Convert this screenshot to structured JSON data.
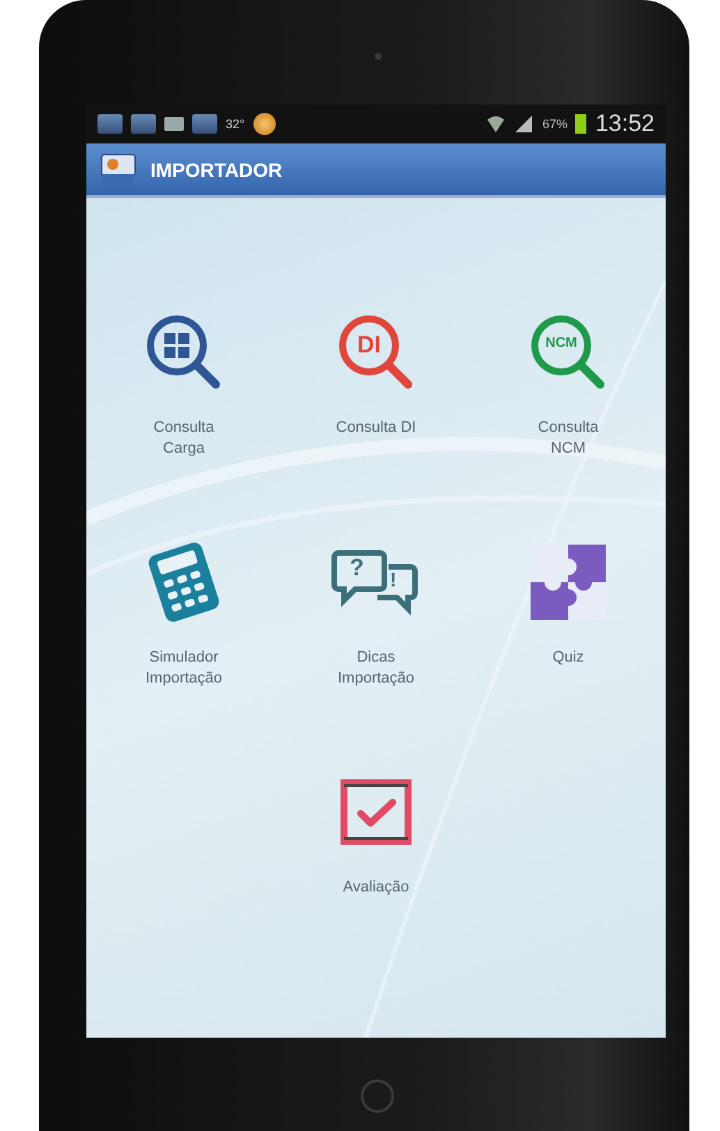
{
  "status_bar": {
    "temperature": "32°",
    "battery": "67%",
    "time": "13:52"
  },
  "app_bar": {
    "title": "IMPORTADOR"
  },
  "rows": [
    [
      {
        "label": "Consulta Carga",
        "kind": "magnifier-grid",
        "color": "#2e5594"
      },
      {
        "label": "Consulta DI",
        "kind": "magnifier-text",
        "color": "#e0463c",
        "glyph": "DI"
      },
      {
        "label": "Consulta NCM",
        "kind": "magnifier-text",
        "color": "#1f9a4a",
        "glyph": "NCM"
      }
    ],
    [
      {
        "label": "Simulador Importação",
        "kind": "calculator",
        "color": "#1b7f9e"
      },
      {
        "label": "Dicas Importação",
        "kind": "bubbles",
        "color": "#3d6f7a",
        "glyphs": [
          "?",
          "!"
        ]
      },
      {
        "label": "Quiz",
        "kind": "puzzle",
        "color": "#7a5cc0"
      }
    ],
    [
      {
        "label": "Avaliação",
        "kind": "checkbox",
        "color": "#e04a64"
      }
    ]
  ]
}
